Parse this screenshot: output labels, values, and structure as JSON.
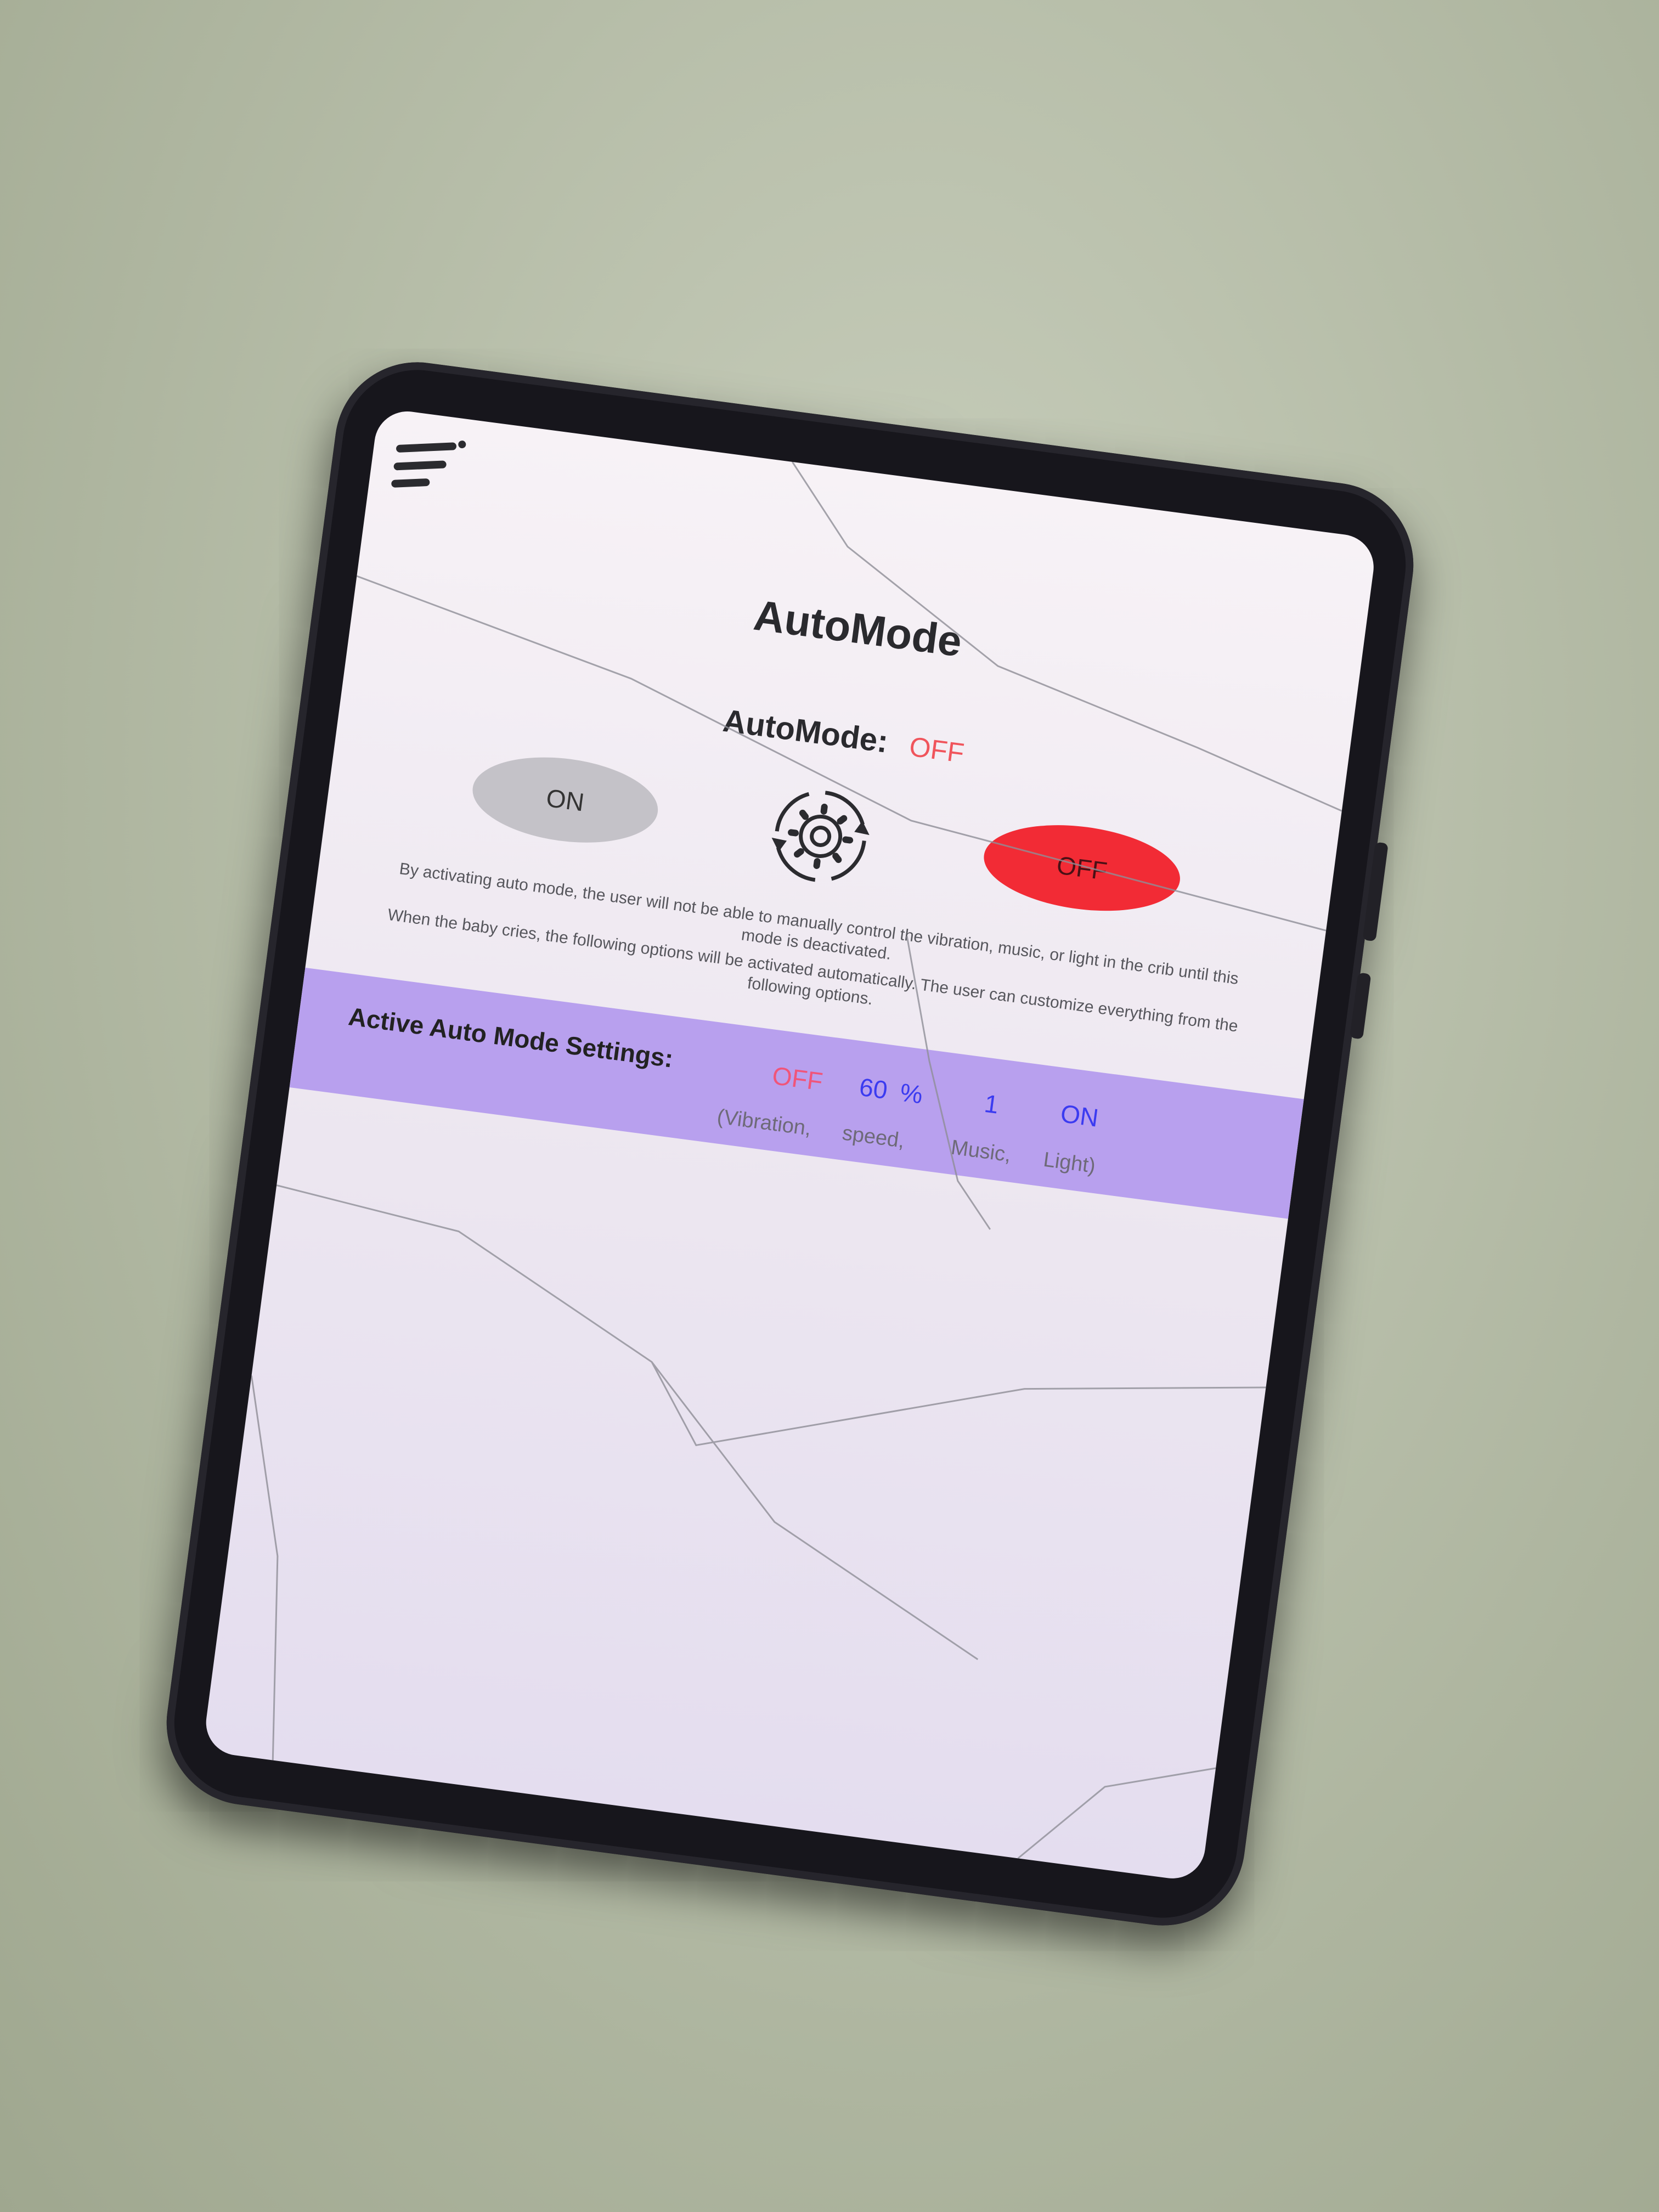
{
  "app": {
    "page_title": "AutoMode"
  },
  "status": {
    "label": "AutoMode:",
    "value": "OFF"
  },
  "controls": {
    "on_label": "ON",
    "off_label": "OFF"
  },
  "description": {
    "line1": "By activating auto mode, the user will not be able to manually control the vibration, music, or light in the crib until this mode is deactivated.",
    "line2": "When the baby cries, the following options will be activated automatically. The user can customize everything from the following options."
  },
  "settings": {
    "label": "Active Auto Mode Settings:",
    "vibration_value": "OFF",
    "speed_value": "60",
    "speed_unit": "%",
    "music_value": "1",
    "light_value": "ON",
    "vibration_caption": "(Vibration,",
    "speed_caption": "speed,",
    "music_caption": "Music,",
    "light_caption": "Light)"
  },
  "colors": {
    "status_off": "#f0555c",
    "off_button": "#f22b35",
    "on_button": "#c4c2c8",
    "settings_band": "#b8a0ee",
    "value_blue": "#3b3bf0",
    "value_pink": "#f0557a"
  },
  "icons": {
    "menu": "menu-icon",
    "auto_mode": "gear-cycle-icon"
  }
}
